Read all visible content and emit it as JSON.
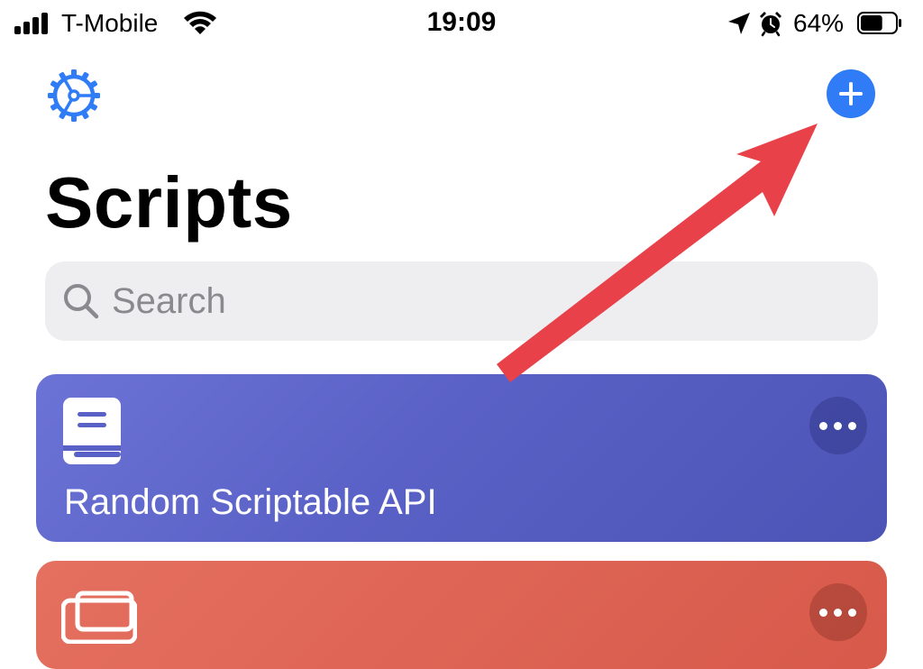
{
  "status_bar": {
    "carrier": "T-Mobile",
    "time": "19:09",
    "battery_percent": "64%",
    "battery_level": 0.64,
    "icons": [
      "signal-icon",
      "wifi-icon",
      "location-arrow-icon",
      "alarm-clock-icon",
      "battery-icon"
    ]
  },
  "nav": {
    "settings_icon": "gear-icon",
    "add_icon": "plus-icon"
  },
  "page": {
    "title": "Scripts"
  },
  "search": {
    "placeholder": "Search",
    "value": ""
  },
  "scripts": [
    {
      "name": "Random Scriptable API",
      "icon": "book-icon",
      "color": "#5a61c6"
    },
    {
      "name": "",
      "icon": "newspaper-icon",
      "color": "#d95c4d"
    }
  ],
  "colors": {
    "accent": "#2f7cf6",
    "arrow": "#e8414a"
  }
}
